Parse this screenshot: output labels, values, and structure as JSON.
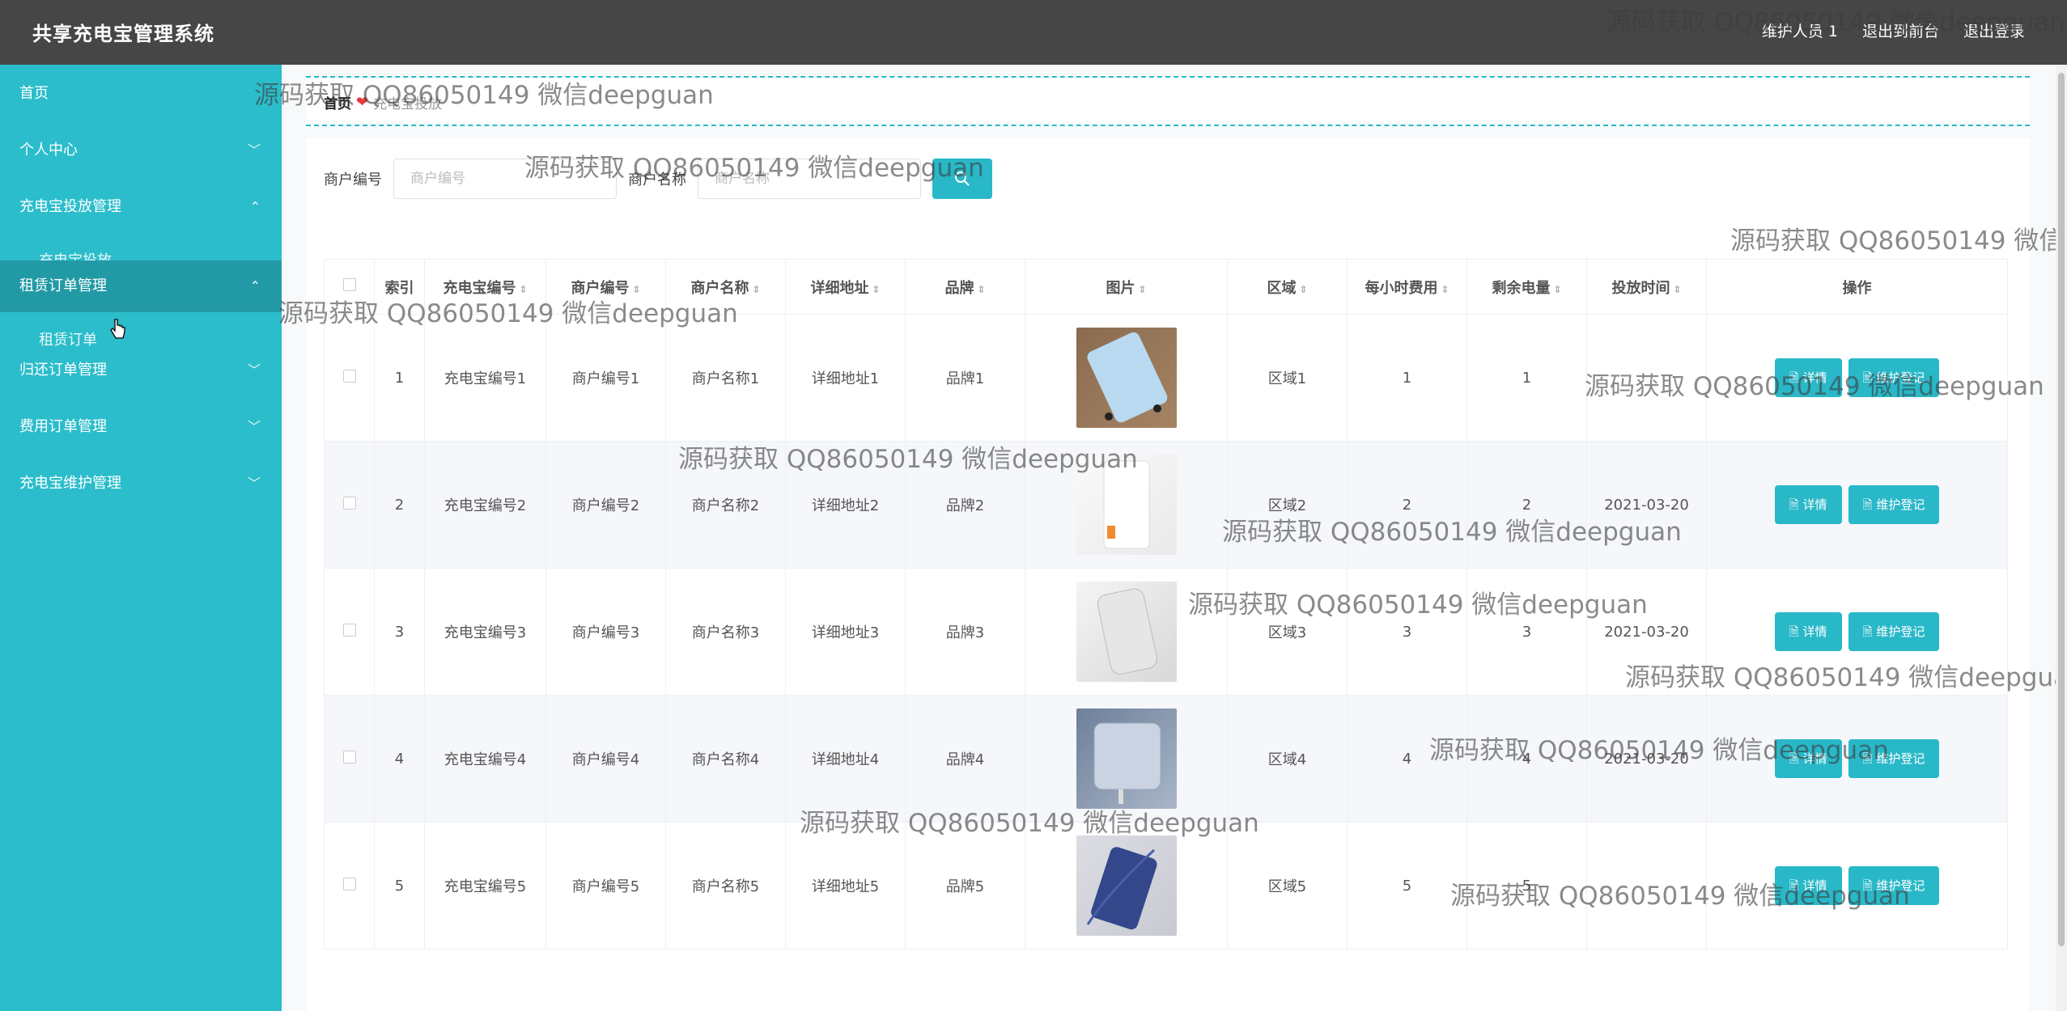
{
  "app": {
    "title": "共享充电宝管理系统"
  },
  "header": {
    "user": "维护人员 1",
    "back_front": "退出到前台",
    "logout": "退出登录"
  },
  "sidebar": {
    "items": [
      {
        "label": "首页"
      },
      {
        "label": "个人中心"
      },
      {
        "label": "充电宝投放管理",
        "sub": "充电宝投放"
      },
      {
        "label": "租赁订单管理",
        "sub": "租赁订单"
      },
      {
        "label": "归还订单管理"
      },
      {
        "label": "费用订单管理"
      },
      {
        "label": "充电宝维护管理"
      }
    ]
  },
  "breadcrumb": {
    "home": "首页",
    "current": "充电宝投放"
  },
  "search": {
    "merchant_no_label": "商户编号",
    "merchant_no_placeholder": "商户编号",
    "merchant_name_label": "商户名称",
    "merchant_name_placeholder": "商户名称"
  },
  "table": {
    "columns": [
      "索引",
      "充电宝编号",
      "商户编号",
      "商户名称",
      "详细地址",
      "品牌",
      "图片",
      "区域",
      "每小时费用",
      "剩余电量",
      "投放时间",
      "操作"
    ],
    "rows": [
      {
        "idx": "1",
        "pb_no": "充电宝编号1",
        "m_no": "商户编号1",
        "m_name": "商户名称1",
        "addr": "详细地址1",
        "brand": "品牌1",
        "img": "light-blue-powerbank",
        "area": "区域1",
        "fee": "1",
        "battery": "1",
        "time": ""
      },
      {
        "idx": "2",
        "pb_no": "充电宝编号2",
        "m_no": "商户编号2",
        "m_name": "商户名称2",
        "addr": "详细地址2",
        "brand": "品牌2",
        "img": "white-powerbank",
        "area": "区域2",
        "fee": "2",
        "battery": "2",
        "time": "2021-03-20"
      },
      {
        "idx": "3",
        "pb_no": "充电宝编号3",
        "m_no": "商户编号3",
        "m_name": "商户名称3",
        "addr": "详细地址3",
        "brand": "品牌3",
        "img": "silver-powerbank",
        "area": "区域3",
        "fee": "3",
        "battery": "3",
        "time": "2021-03-20"
      },
      {
        "idx": "4",
        "pb_no": "充电宝编号4",
        "m_no": "商户编号4",
        "m_name": "商户名称4",
        "addr": "详细地址4",
        "brand": "品牌4",
        "img": "gray-blue-powerbank",
        "area": "区域4",
        "fee": "4",
        "battery": "4",
        "time": "2021-03-20"
      },
      {
        "idx": "5",
        "pb_no": "充电宝编号5",
        "m_no": "商户编号5",
        "m_name": "商户名称5",
        "addr": "详细地址5",
        "brand": "品牌5",
        "img": "navy-powerbank",
        "area": "区域5",
        "fee": "5",
        "battery": "5",
        "time": ""
      }
    ],
    "detail_label": "详情",
    "maintain_label": "维护登记"
  },
  "watermark": "源码获取 QQ86050149 微信deepguan"
}
